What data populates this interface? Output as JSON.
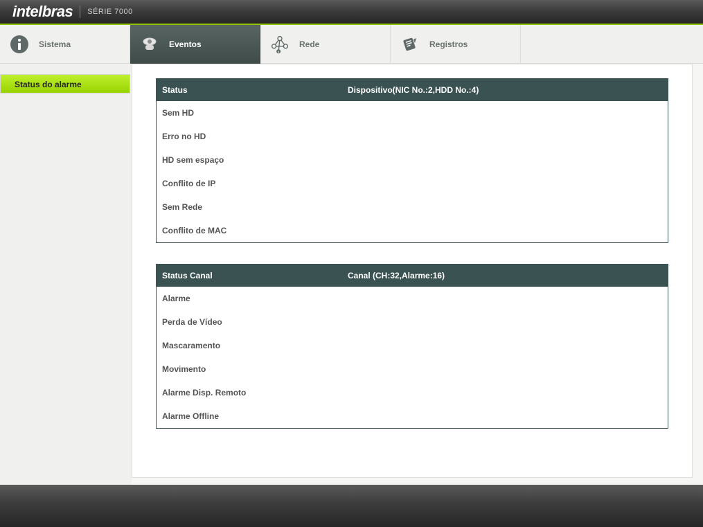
{
  "brand": "intelbras",
  "series": "SÉRIE 7000",
  "nav": {
    "sistema": "Sistema",
    "eventos": "Eventos",
    "rede": "Rede",
    "registros": "Registros"
  },
  "sidebar": {
    "alarm_status": "Status do alarme"
  },
  "panel1": {
    "col1": "Status",
    "col2": "Dispositivo(NIC No.:2,HDD No.:4)",
    "rows": {
      "r0": "Sem HD",
      "r1": "Erro no HD",
      "r2": "HD sem espaço",
      "r3": "Conflito de IP",
      "r4": "Sem Rede",
      "r5": "Conflito de MAC"
    }
  },
  "panel2": {
    "col1": "Status Canal",
    "col2": "Canal (CH:32,Alarme:16)",
    "rows": {
      "r0": "Alarme",
      "r1": "Perda de Vídeo",
      "r2": "Mascaramento",
      "r3": "Movimento",
      "r4": "Alarme Disp. Remoto",
      "r5": "Alarme Offline"
    }
  }
}
